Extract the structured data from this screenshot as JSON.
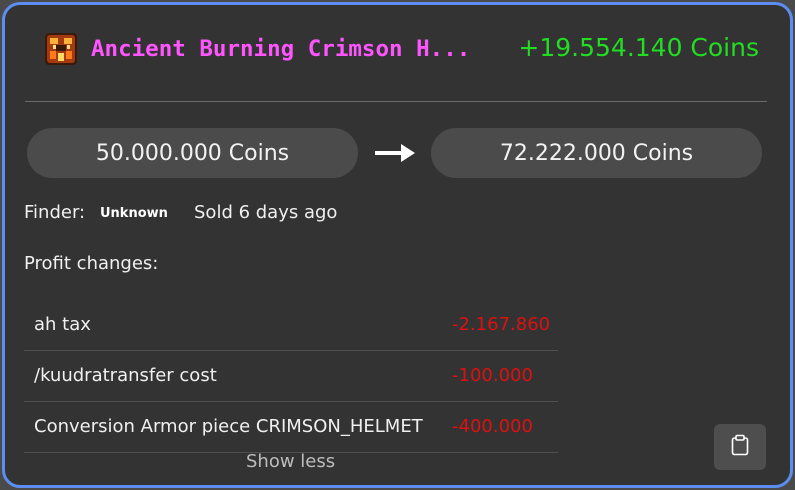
{
  "item": {
    "name": "Ancient Burning Crimson H...",
    "icon": "crimson-helmet-icon",
    "profit": "+19.554.140 Coins"
  },
  "prices": {
    "buy": "50.000.000 Coins",
    "sell": "72.222.000 Coins"
  },
  "finder": {
    "label": "Finder:",
    "value": "Unknown",
    "sold": "Sold 6 days ago"
  },
  "profit_changes": {
    "title": "Profit changes:",
    "items": [
      {
        "label": "ah tax",
        "value": "-2.167.860"
      },
      {
        "label": "/kuudratransfer cost",
        "value": "-100.000"
      },
      {
        "label": "Conversion Armor piece CRIMSON_HELMET",
        "value": "-400.000"
      }
    ],
    "toggle": "Show less"
  },
  "colors": {
    "name": "#ff55ff",
    "profit": "#22dd22",
    "negative": "#dd1111",
    "border": "#5b8ef0"
  }
}
